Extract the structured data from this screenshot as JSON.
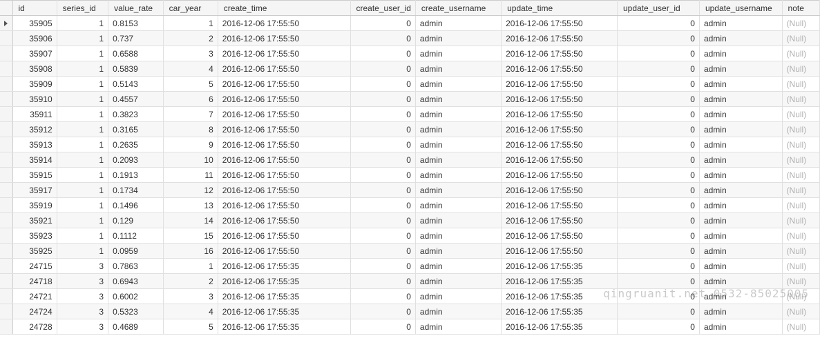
{
  "watermark": "qingruanit.net 0532-85025005",
  "null_label": "(Null)",
  "columns": [
    {
      "key": "id",
      "label": "id",
      "align": "num",
      "cls": "c-id"
    },
    {
      "key": "series_id",
      "label": "series_id",
      "align": "num",
      "cls": "c-series"
    },
    {
      "key": "value_rate",
      "label": "value_rate",
      "align": "txt",
      "cls": "c-value"
    },
    {
      "key": "car_year",
      "label": "car_year",
      "align": "num",
      "cls": "c-car"
    },
    {
      "key": "create_time",
      "label": "create_time",
      "align": "txt",
      "cls": "c-ctime"
    },
    {
      "key": "create_user_id",
      "label": "create_user_id",
      "align": "num",
      "cls": "c-cuid"
    },
    {
      "key": "create_username",
      "label": "create_username",
      "align": "txt",
      "cls": "c-cuname"
    },
    {
      "key": "update_time",
      "label": "update_time",
      "align": "txt",
      "cls": "c-utime"
    },
    {
      "key": "update_user_id",
      "label": "update_user_id",
      "align": "num",
      "cls": "c-uuid"
    },
    {
      "key": "update_username",
      "label": "update_username",
      "align": "txt",
      "cls": "c-uuname"
    },
    {
      "key": "note",
      "label": "note",
      "align": "txt",
      "cls": "c-note"
    }
  ],
  "rows": [
    {
      "id": "35905",
      "series_id": "1",
      "value_rate": "0.8153",
      "car_year": "1",
      "create_time": "2016-12-06 17:55:50",
      "create_user_id": "0",
      "create_username": "admin",
      "update_time": "2016-12-06 17:55:50",
      "update_user_id": "0",
      "update_username": "admin",
      "note": null,
      "current": true
    },
    {
      "id": "35906",
      "series_id": "1",
      "value_rate": "0.737",
      "car_year": "2",
      "create_time": "2016-12-06 17:55:50",
      "create_user_id": "0",
      "create_username": "admin",
      "update_time": "2016-12-06 17:55:50",
      "update_user_id": "0",
      "update_username": "admin",
      "note": null
    },
    {
      "id": "35907",
      "series_id": "1",
      "value_rate": "0.6588",
      "car_year": "3",
      "create_time": "2016-12-06 17:55:50",
      "create_user_id": "0",
      "create_username": "admin",
      "update_time": "2016-12-06 17:55:50",
      "update_user_id": "0",
      "update_username": "admin",
      "note": null
    },
    {
      "id": "35908",
      "series_id": "1",
      "value_rate": "0.5839",
      "car_year": "4",
      "create_time": "2016-12-06 17:55:50",
      "create_user_id": "0",
      "create_username": "admin",
      "update_time": "2016-12-06 17:55:50",
      "update_user_id": "0",
      "update_username": "admin",
      "note": null
    },
    {
      "id": "35909",
      "series_id": "1",
      "value_rate": "0.5143",
      "car_year": "5",
      "create_time": "2016-12-06 17:55:50",
      "create_user_id": "0",
      "create_username": "admin",
      "update_time": "2016-12-06 17:55:50",
      "update_user_id": "0",
      "update_username": "admin",
      "note": null
    },
    {
      "id": "35910",
      "series_id": "1",
      "value_rate": "0.4557",
      "car_year": "6",
      "create_time": "2016-12-06 17:55:50",
      "create_user_id": "0",
      "create_username": "admin",
      "update_time": "2016-12-06 17:55:50",
      "update_user_id": "0",
      "update_username": "admin",
      "note": null
    },
    {
      "id": "35911",
      "series_id": "1",
      "value_rate": "0.3823",
      "car_year": "7",
      "create_time": "2016-12-06 17:55:50",
      "create_user_id": "0",
      "create_username": "admin",
      "update_time": "2016-12-06 17:55:50",
      "update_user_id": "0",
      "update_username": "admin",
      "note": null
    },
    {
      "id": "35912",
      "series_id": "1",
      "value_rate": "0.3165",
      "car_year": "8",
      "create_time": "2016-12-06 17:55:50",
      "create_user_id": "0",
      "create_username": "admin",
      "update_time": "2016-12-06 17:55:50",
      "update_user_id": "0",
      "update_username": "admin",
      "note": null
    },
    {
      "id": "35913",
      "series_id": "1",
      "value_rate": "0.2635",
      "car_year": "9",
      "create_time": "2016-12-06 17:55:50",
      "create_user_id": "0",
      "create_username": "admin",
      "update_time": "2016-12-06 17:55:50",
      "update_user_id": "0",
      "update_username": "admin",
      "note": null
    },
    {
      "id": "35914",
      "series_id": "1",
      "value_rate": "0.2093",
      "car_year": "10",
      "create_time": "2016-12-06 17:55:50",
      "create_user_id": "0",
      "create_username": "admin",
      "update_time": "2016-12-06 17:55:50",
      "update_user_id": "0",
      "update_username": "admin",
      "note": null
    },
    {
      "id": "35915",
      "series_id": "1",
      "value_rate": "0.1913",
      "car_year": "11",
      "create_time": "2016-12-06 17:55:50",
      "create_user_id": "0",
      "create_username": "admin",
      "update_time": "2016-12-06 17:55:50",
      "update_user_id": "0",
      "update_username": "admin",
      "note": null
    },
    {
      "id": "35917",
      "series_id": "1",
      "value_rate": "0.1734",
      "car_year": "12",
      "create_time": "2016-12-06 17:55:50",
      "create_user_id": "0",
      "create_username": "admin",
      "update_time": "2016-12-06 17:55:50",
      "update_user_id": "0",
      "update_username": "admin",
      "note": null
    },
    {
      "id": "35919",
      "series_id": "1",
      "value_rate": "0.1496",
      "car_year": "13",
      "create_time": "2016-12-06 17:55:50",
      "create_user_id": "0",
      "create_username": "admin",
      "update_time": "2016-12-06 17:55:50",
      "update_user_id": "0",
      "update_username": "admin",
      "note": null
    },
    {
      "id": "35921",
      "series_id": "1",
      "value_rate": "0.129",
      "car_year": "14",
      "create_time": "2016-12-06 17:55:50",
      "create_user_id": "0",
      "create_username": "admin",
      "update_time": "2016-12-06 17:55:50",
      "update_user_id": "0",
      "update_username": "admin",
      "note": null
    },
    {
      "id": "35923",
      "series_id": "1",
      "value_rate": "0.1112",
      "car_year": "15",
      "create_time": "2016-12-06 17:55:50",
      "create_user_id": "0",
      "create_username": "admin",
      "update_time": "2016-12-06 17:55:50",
      "update_user_id": "0",
      "update_username": "admin",
      "note": null
    },
    {
      "id": "35925",
      "series_id": "1",
      "value_rate": "0.0959",
      "car_year": "16",
      "create_time": "2016-12-06 17:55:50",
      "create_user_id": "0",
      "create_username": "admin",
      "update_time": "2016-12-06 17:55:50",
      "update_user_id": "0",
      "update_username": "admin",
      "note": null
    },
    {
      "id": "24715",
      "series_id": "3",
      "value_rate": "0.7863",
      "car_year": "1",
      "create_time": "2016-12-06 17:55:35",
      "create_user_id": "0",
      "create_username": "admin",
      "update_time": "2016-12-06 17:55:35",
      "update_user_id": "0",
      "update_username": "admin",
      "note": null
    },
    {
      "id": "24718",
      "series_id": "3",
      "value_rate": "0.6943",
      "car_year": "2",
      "create_time": "2016-12-06 17:55:35",
      "create_user_id": "0",
      "create_username": "admin",
      "update_time": "2016-12-06 17:55:35",
      "update_user_id": "0",
      "update_username": "admin",
      "note": null
    },
    {
      "id": "24721",
      "series_id": "3",
      "value_rate": "0.6002",
      "car_year": "3",
      "create_time": "2016-12-06 17:55:35",
      "create_user_id": "0",
      "create_username": "admin",
      "update_time": "2016-12-06 17:55:35",
      "update_user_id": "0",
      "update_username": "admin",
      "note": null
    },
    {
      "id": "24724",
      "series_id": "3",
      "value_rate": "0.5323",
      "car_year": "4",
      "create_time": "2016-12-06 17:55:35",
      "create_user_id": "0",
      "create_username": "admin",
      "update_time": "2016-12-06 17:55:35",
      "update_user_id": "0",
      "update_username": "admin",
      "note": null
    },
    {
      "id": "24728",
      "series_id": "3",
      "value_rate": "0.4689",
      "car_year": "5",
      "create_time": "2016-12-06 17:55:35",
      "create_user_id": "0",
      "create_username": "admin",
      "update_time": "2016-12-06 17:55:35",
      "update_user_id": "0",
      "update_username": "admin",
      "note": null
    }
  ]
}
